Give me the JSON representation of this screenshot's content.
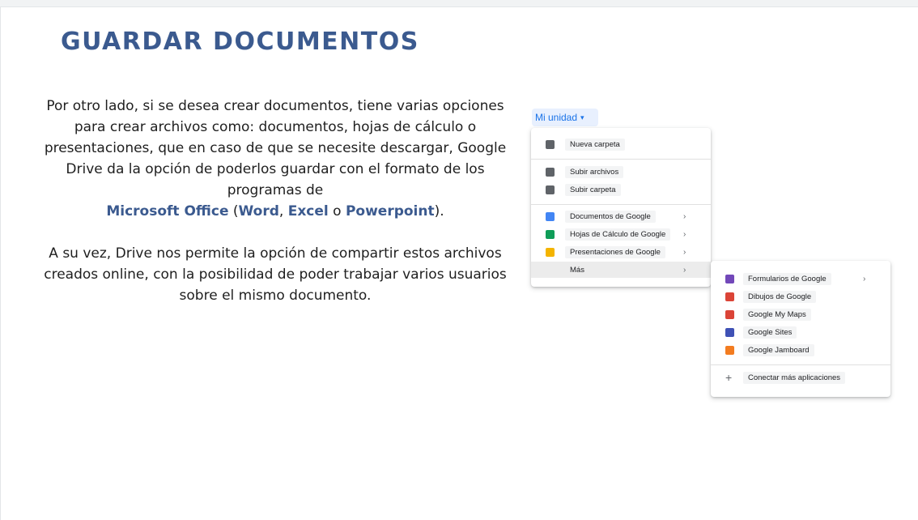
{
  "slide": {
    "title": "GUARDAR DOCUMENTOS",
    "p1_a": "Por otro lado, si se desea crear documentos, tiene varias opciones para crear archivos como: documentos, hojas de cálculo o presentaciones, que en caso de que se necesite descargar, Google Drive  da la opción de poderlos guardar con el formato de los programas de",
    "p1_ms": "Microsoft Office",
    "p1_open": "(",
    "p1_word": "Word",
    "p1_comma": ",",
    "p1_excel": "Excel",
    "p1_o": "o",
    "p1_ppt": "Powerpoint",
    "p1_close": ").",
    "p2": "A su vez, Drive nos permite la opción de compartir estos archivos creados online, con la posibilidad de poder trabajar varios usuarios sobre el mismo documento."
  },
  "drive": {
    "button_label": "Mi unidad",
    "caret": "▾",
    "menu": {
      "new_folder": "Nueva carpeta",
      "upload_files": "Subir archivos",
      "upload_folder": "Subir carpeta",
      "docs": "Documentos de Google",
      "sheets": "Hojas de Cálculo de Google",
      "slides": "Presentaciones de Google",
      "more": "Más",
      "arrow": "›"
    },
    "submenu": {
      "forms": "Formularios de Google",
      "drawings": "Dibujos de Google",
      "mymaps": "Google My Maps",
      "sites": "Google Sites",
      "jamboard": "Google Jamboard",
      "connect": "Conectar más aplicaciones",
      "plus": "+"
    }
  },
  "colors": {
    "title": "#3b5a8f",
    "docs": "#4285f4",
    "sheets": "#0f9d58",
    "slides": "#f4b400",
    "forms": "#7248b9",
    "drawings": "#db4437",
    "mymaps": "#db4437",
    "sites": "#3f51b5",
    "jamboard": "#f37c20"
  }
}
